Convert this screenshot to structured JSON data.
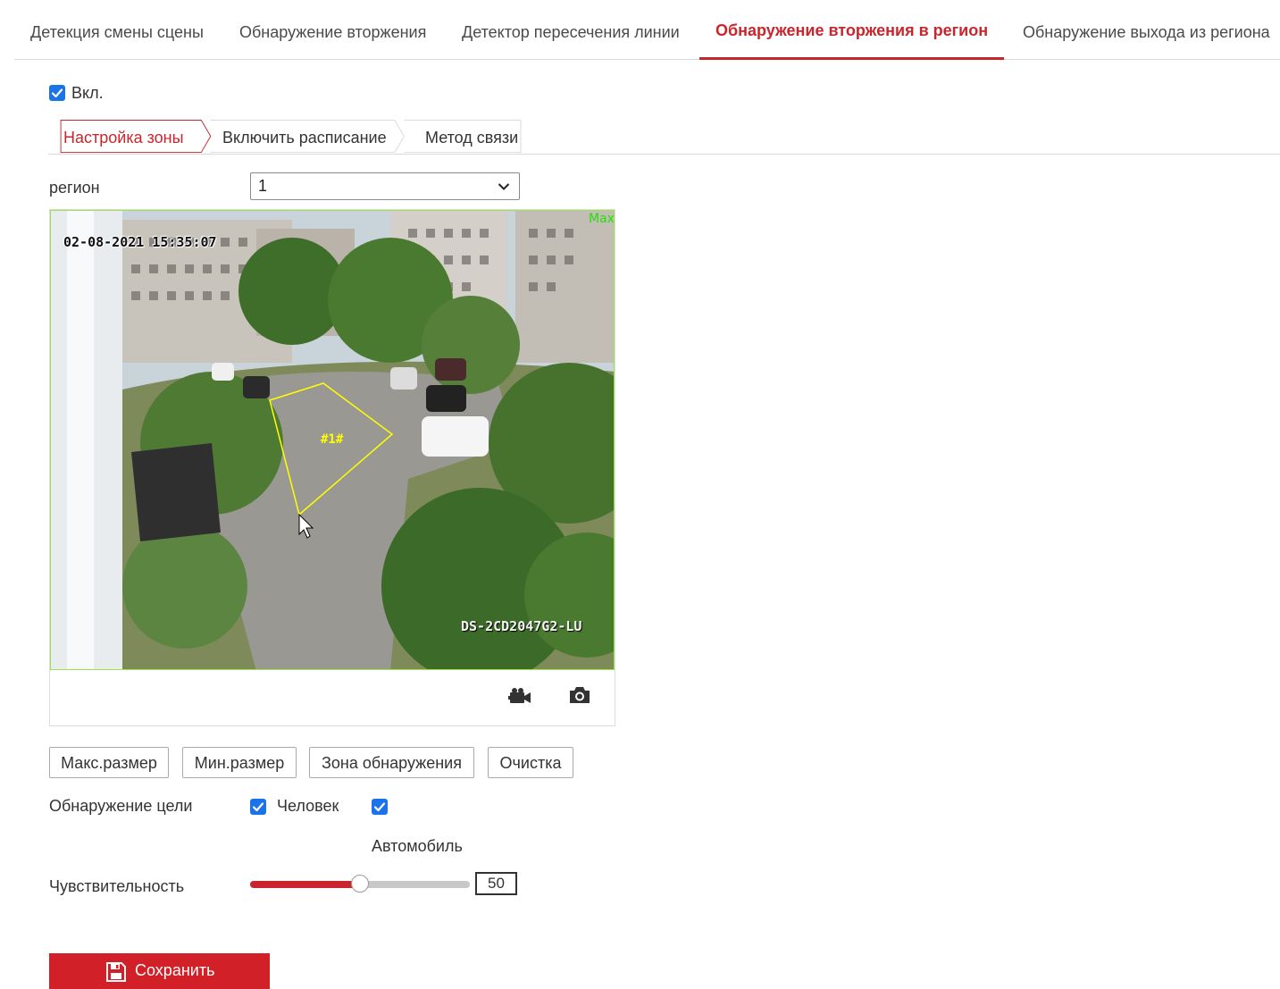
{
  "top_tabs": [
    {
      "label": "Детекция смены сцены",
      "active": false
    },
    {
      "label": "Обнаружение вторжения",
      "active": false
    },
    {
      "label": "Детектор пересечения линии",
      "active": false
    },
    {
      "label": "Обнаружение вторжения в регион",
      "active": true
    },
    {
      "label": "Обнаружение выхода из региона",
      "active": false
    }
  ],
  "enable": {
    "label": "Вкл.",
    "checked": true
  },
  "sub_tabs": [
    {
      "label": "Настройка зоны",
      "active": true
    },
    {
      "label": "Включить расписание",
      "active": false
    },
    {
      "label": "Метод связи",
      "active": false
    }
  ],
  "region": {
    "label": "регион",
    "selected": "1"
  },
  "video": {
    "timestamp": "02-08-2021 15:35:07",
    "max_label": "Max",
    "region_label": "#1#",
    "camera_model": "DS-2CD2047G2-LU",
    "region_color": "#ffff00",
    "icons": [
      "record-icon",
      "camera-icon"
    ]
  },
  "buttons": {
    "max_size": "Макс.размер",
    "min_size": "Мин.размер",
    "detection_zone": "Зона обнаружения",
    "clear": "Очистка"
  },
  "target_detection": {
    "label": "Обнаружение цели",
    "human": {
      "label": "Человек",
      "checked": true
    },
    "vehicle": {
      "label": "Автомобиль",
      "checked": true
    }
  },
  "sensitivity": {
    "label": "Чувствительность",
    "value": "50",
    "max": 100
  },
  "save": {
    "label": "Сохранить"
  },
  "colors": {
    "accent": "#c8262c",
    "checkbox": "#1a73e8",
    "save_button": "#d12027"
  }
}
